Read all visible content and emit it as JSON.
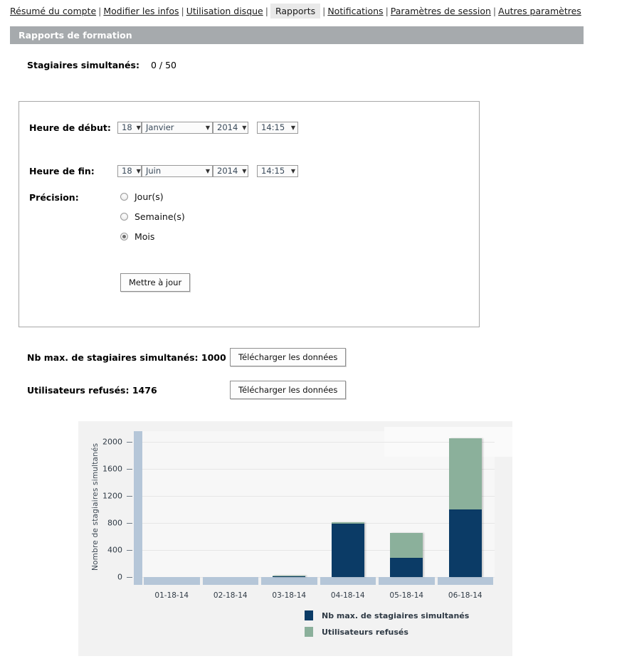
{
  "nav": {
    "separator": "|",
    "items": [
      {
        "label": "Résumé du compte",
        "current": false
      },
      {
        "label": "Modifier les infos",
        "current": false
      },
      {
        "label": "Utilisation disque",
        "current": false
      },
      {
        "label": "Rapports",
        "current": true
      },
      {
        "label": "Notifications",
        "current": false
      },
      {
        "label": "Paramètres de session",
        "current": false
      },
      {
        "label": "Autres paramètres",
        "current": false
      }
    ]
  },
  "section": {
    "title": "Rapports de formation",
    "bar_color": "#a6aaad"
  },
  "stats": {
    "concurrent_label": "Stagiaires simultanés:",
    "concurrent_value": "0 / 50"
  },
  "form": {
    "start": {
      "label": "Heure de début:",
      "day": "18",
      "month": "Janvier",
      "year": "2014",
      "time": "14:15"
    },
    "end": {
      "label": "Heure de fin:",
      "day": "18",
      "month": "Juin",
      "year": "2014",
      "time": "14:15"
    },
    "precision": {
      "label": "Précision:",
      "options": [
        {
          "label": "Jour(s)",
          "selected": false
        },
        {
          "label": "Semaine(s)",
          "selected": false
        },
        {
          "label": "Mois",
          "selected": true
        }
      ]
    },
    "update_button": "Mettre à jour",
    "caret": "▼"
  },
  "downloads": [
    {
      "label": "Nb max. de stagiaires simultanés: 1000",
      "button": "Télécharger les données"
    },
    {
      "label": "Utilisateurs refusés: 1476",
      "button": "Télécharger les données"
    }
  ],
  "chart_data": {
    "type": "bar",
    "stacked": true,
    "title": "",
    "xlabel": "",
    "ylabel": "Nombre de stagiaires simultanés",
    "categories": [
      "01-18-14",
      "02-18-14",
      "03-18-14",
      "04-18-14",
      "05-18-14",
      "06-18-14"
    ],
    "series": [
      {
        "name": "Nb max. de stagiaires simultanés",
        "color": "#0b3b66",
        "values": [
          0,
          0,
          20,
          790,
          285,
          1000
        ]
      },
      {
        "name": "Utilisateurs refusés",
        "color": "#8bb09b",
        "values": [
          0,
          0,
          5,
          25,
          365,
          1050
        ]
      }
    ],
    "yticks": [
      0,
      400,
      800,
      1200,
      1600,
      2000
    ],
    "ylim": [
      0,
      2160
    ],
    "grid": true,
    "legend_position": "bottom"
  }
}
